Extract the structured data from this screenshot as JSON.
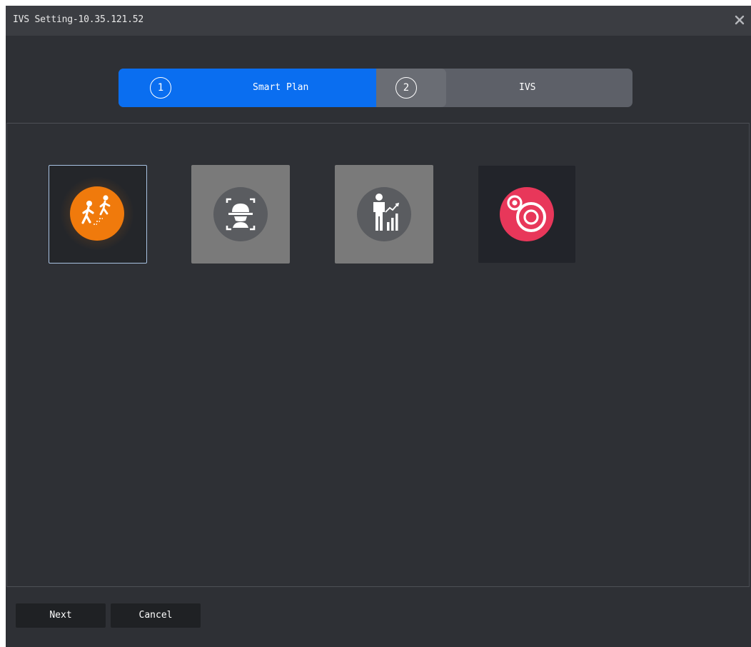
{
  "window": {
    "title": "IVS Setting-10.35.121.52"
  },
  "steps": [
    {
      "number": "1",
      "label": "Smart Plan"
    },
    {
      "number": "2",
      "label": "IVS"
    }
  ],
  "smart_plans": [
    {
      "icon": "people-counting-icon",
      "selected": true,
      "color": "#f07a0c"
    },
    {
      "icon": "face-detection-icon",
      "selected": false,
      "color": "#5a5c60"
    },
    {
      "icon": "people-statistics-icon",
      "selected": false,
      "color": "#5a5c60"
    },
    {
      "icon": "ivs-target-icon",
      "selected": false,
      "color": "#e8375a"
    }
  ],
  "footer": {
    "next_label": "Next",
    "cancel_label": "Cancel"
  },
  "colors": {
    "accent": "#0a6ef0",
    "background": "#2e3035",
    "titlebar": "#3b3d42"
  }
}
